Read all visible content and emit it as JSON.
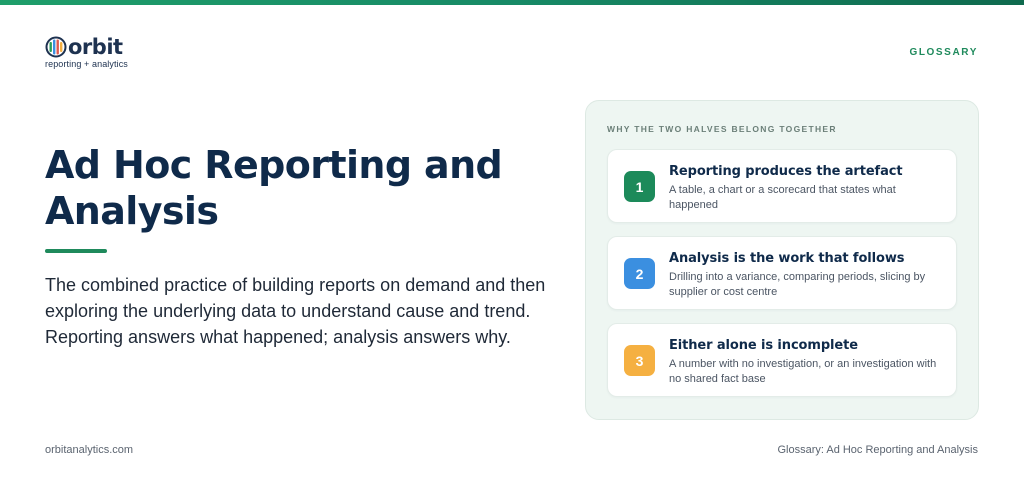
{
  "brand": {
    "name": "orbit",
    "tagline": "reporting + analytics"
  },
  "header": {
    "section_label": "GLOSSARY"
  },
  "main": {
    "title": "Ad Hoc Reporting and Analysis",
    "lede": "The combined practice of building reports on demand and then exploring the underlying data to understand cause and trend. Reporting answers what happened; analysis answers why."
  },
  "panel": {
    "heading": "WHY THE TWO HALVES BELONG TOGETHER",
    "cards": [
      {
        "number": "1",
        "title": "Reporting produces the artefact",
        "description": "A table, a chart or a scorecard that states what happened",
        "color": "#1c8a5a"
      },
      {
        "number": "2",
        "title": "Analysis is the work that follows",
        "description": "Drilling into a variance, comparing periods, slicing by supplier or cost centre",
        "color": "#3b8fe0"
      },
      {
        "number": "3",
        "title": "Either alone is incomplete",
        "description": "A number with no investigation, or an investigation with no shared fact base",
        "color": "#f5b041"
      }
    ]
  },
  "footer": {
    "website": "orbitanalytics.com",
    "page_label": "Glossary: Ad Hoc Reporting and Analysis"
  },
  "colors": {
    "accent": "#1f8a5c",
    "heading": "#0f2a4a",
    "panel_bg": "#eef6f2"
  }
}
